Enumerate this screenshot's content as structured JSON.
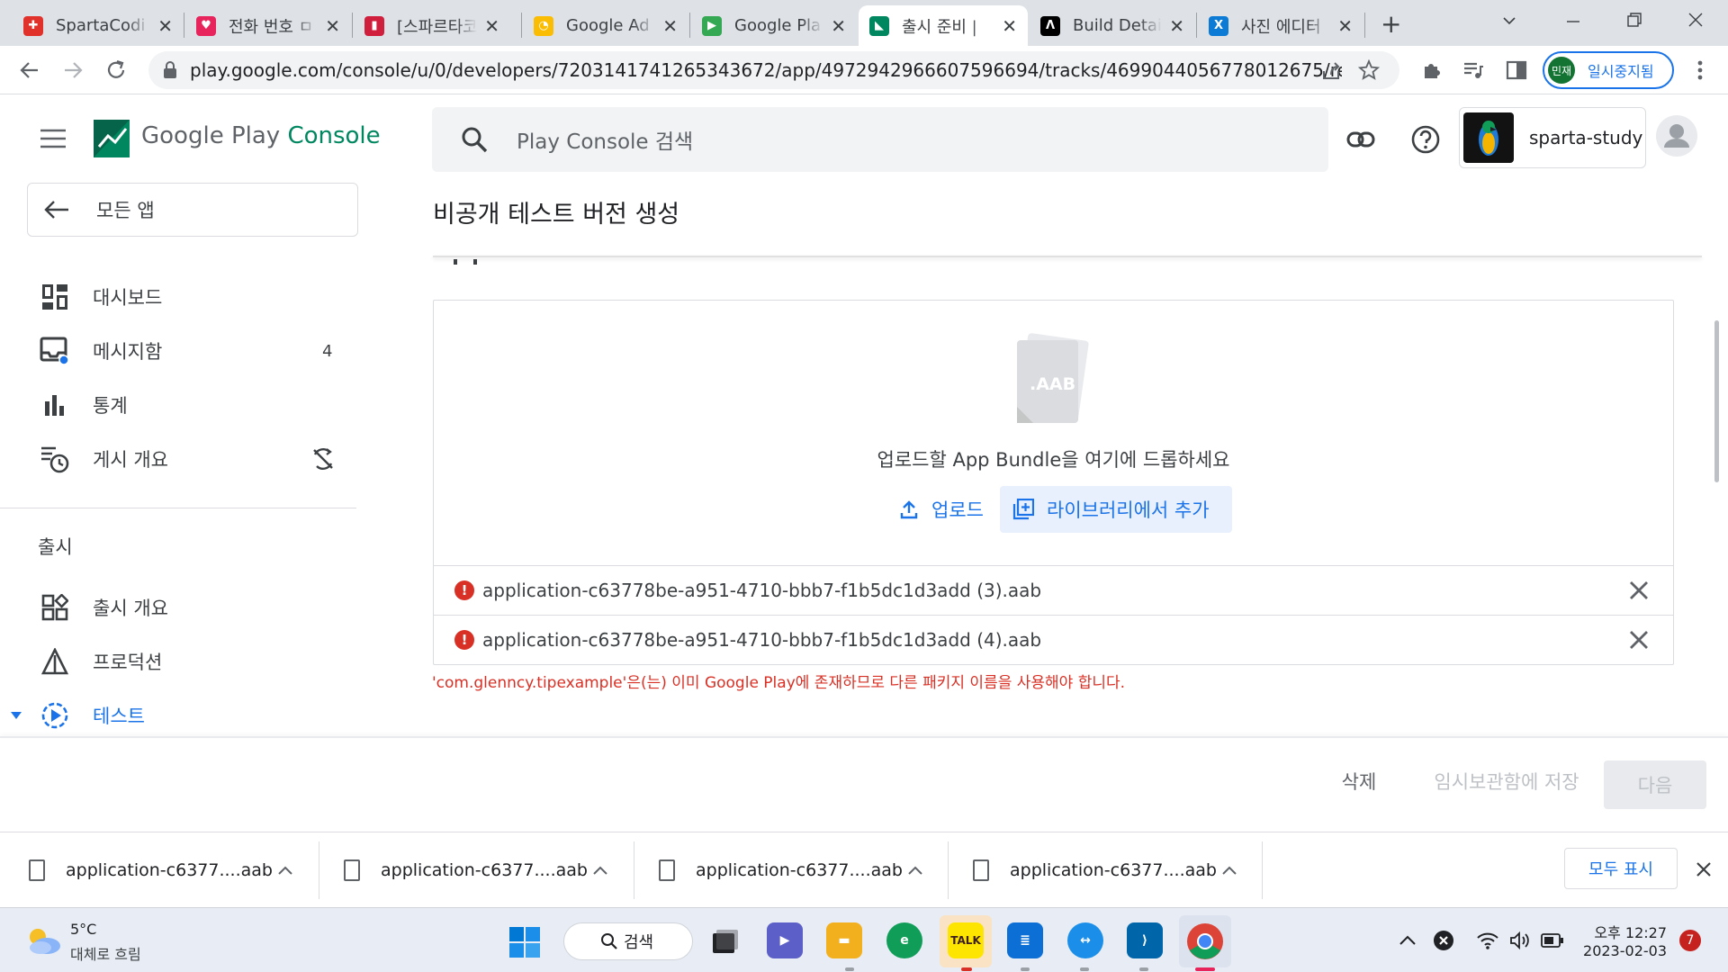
{
  "browser": {
    "tabs": [
      {
        "title": "SpartaCodi",
        "color": "#e0322b",
        "glyph": "✚"
      },
      {
        "title": "전화 번호 ㅁ",
        "color": "#e8245c",
        "glyph": "♥"
      },
      {
        "title": "[스파르타코",
        "color": "#d01f3c",
        "glyph": "▮"
      },
      {
        "title": "Google Ad",
        "color": "#fbbc04",
        "glyph": "◔"
      },
      {
        "title": "Google Pla",
        "color": "#34a853",
        "glyph": "▶"
      },
      {
        "title": "출시 준비 |",
        "color": "#01875f",
        "glyph": "◣"
      },
      {
        "title": "Build Detai",
        "color": "#000000",
        "glyph": "Λ"
      },
      {
        "title": "사진 에디터",
        "color": "#0b7bd6",
        "glyph": "X"
      }
    ],
    "close_tab_glyph": "✕",
    "new_tab_glyph": "+",
    "url": "play.google.com/console/u/0/developers/7203141741265343672/app/4972942966607596694/tracks/4699044056778012675/rele...",
    "profile_avatar": "민재",
    "profile_label": "일시중지됨"
  },
  "console": {
    "brand_google_play": "Google Play",
    "brand_console": "Console",
    "search_placeholder": "Play Console 검색",
    "account_name": "sparta-study",
    "back_label": "모든 앱",
    "nav": [
      {
        "label": "대시보드",
        "icon": "dashboard-icon"
      },
      {
        "label": "메시지함",
        "icon": "inbox-icon",
        "badge": "4"
      },
      {
        "label": "통계",
        "icon": "bar-chart-icon"
      },
      {
        "label": "게시 개요",
        "icon": "publishing-overview-icon"
      }
    ],
    "section_release": "출시",
    "release_nav": [
      {
        "label": "출시 개요",
        "icon": "release-overview-icon"
      },
      {
        "label": "프로덕션",
        "icon": "production-icon"
      },
      {
        "label": "테스트",
        "icon": "testing-icon"
      }
    ]
  },
  "page": {
    "title": "비공개 테스트 버전 생성",
    "aab_badge": ".AAB",
    "drop_text": "업로드할 App Bundle을 여기에 드롭하세요",
    "upload_label": "업로드",
    "library_label": "라이브러리에서 추가",
    "files": [
      {
        "name": "application-c63778be-a951-4710-bbb7-f1b5dc1d3add (3).aab"
      },
      {
        "name": "application-c63778be-a951-4710-bbb7-f1b5dc1d3add (4).aab"
      }
    ],
    "error_message": "'com.glenncy.tipexample'은(는) 이미 Google Play에 존재하므로 다른 패키지 이름을 사용해야 합니다.",
    "delete_label": "삭제",
    "save_draft_label": "임시보관함에 저장",
    "next_label": "다음"
  },
  "downloads": {
    "items": [
      {
        "name": "application-c6377....aab"
      },
      {
        "name": "application-c6377....aab"
      },
      {
        "name": "application-c6377....aab"
      },
      {
        "name": "application-c6377....aab"
      }
    ],
    "show_all_label": "모두 표시"
  },
  "taskbar": {
    "weather_temp": "5°C",
    "weather_desc": "대체로 흐림",
    "search_label": "검색",
    "kakao_label": "TALK",
    "time": "오후 12:27",
    "date": "2023-02-03",
    "notification_count": "7"
  }
}
